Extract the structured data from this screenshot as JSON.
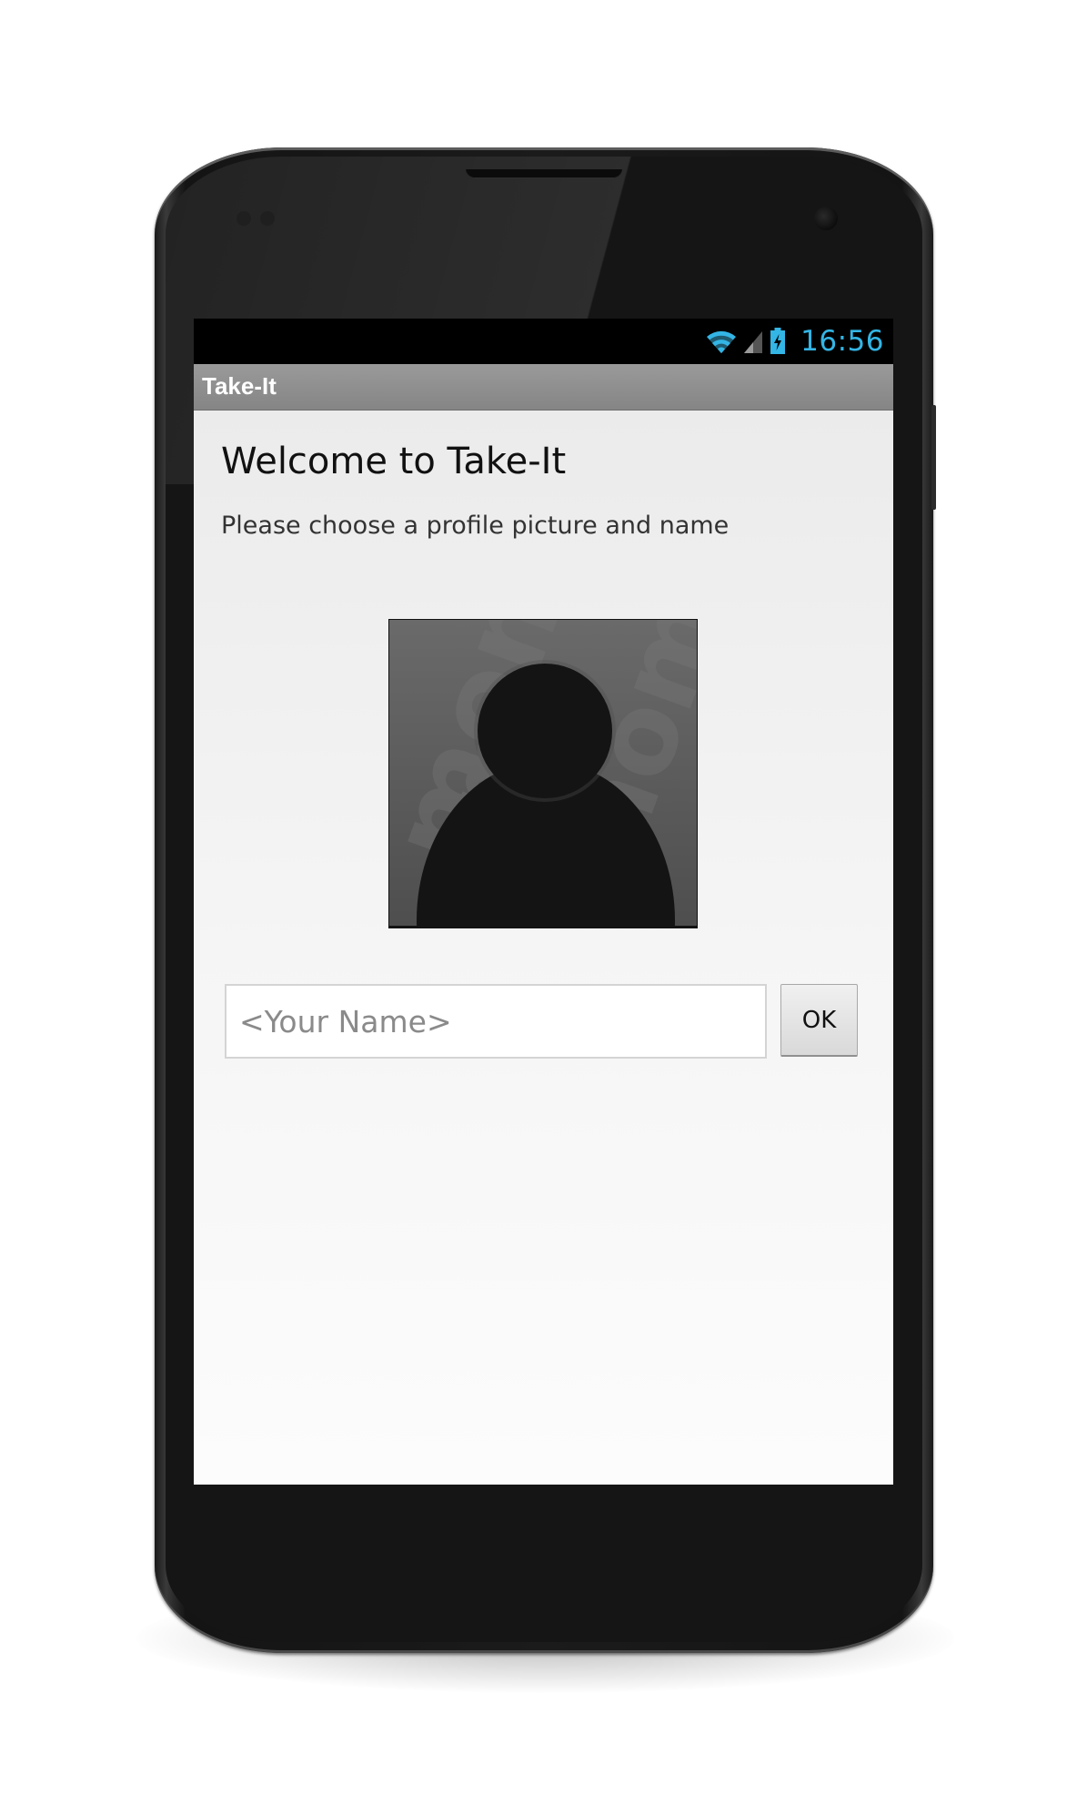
{
  "status_bar": {
    "time": "16:56",
    "icons": [
      "wifi-icon",
      "cell-signal-icon",
      "battery-charging-icon"
    ],
    "accent_color": "#33b5e5"
  },
  "action_bar": {
    "title": "Take-It"
  },
  "main": {
    "title": "Welcome to Take-It",
    "subtitle": "Please choose a profile picture and name",
    "profile_picture": {
      "icon": "default-avatar-icon"
    },
    "name_input": {
      "placeholder": "<Your Name>",
      "value": ""
    },
    "ok_label": "OK"
  }
}
